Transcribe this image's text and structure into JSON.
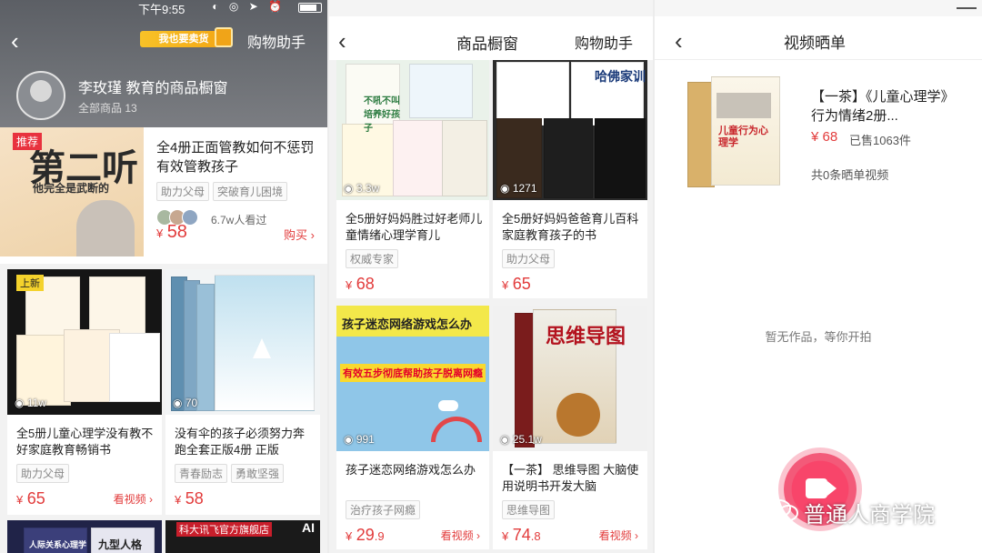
{
  "panel1": {
    "status_time": "下午9:55",
    "seller_button": "我也要卖货",
    "assistant": "购物助手",
    "shop_name": "李玫瑾     教育的商品橱窗",
    "product_count": "全部商品 13",
    "featured": {
      "tag": "推荐",
      "img_big": "第二听",
      "img_sub": "他完全是武断的",
      "title": "全4册正面管教如何不惩罚有效管教孩子",
      "chips": [
        "助力父母",
        "突破育儿困境"
      ],
      "viewers": "6.7w人看过",
      "currency": "¥",
      "price": "58",
      "buy": "购买"
    },
    "cards": [
      {
        "tag": "上新",
        "views": "11w",
        "title": "全5册儿童心理学没有教不好家庭教育畅销书",
        "chips": [
          "助力父母"
        ],
        "price": "65",
        "watch": "看视频"
      },
      {
        "views": "70",
        "title": "没有伞的孩子必须努力奔跑全套正版4册 正版",
        "chips": [
          "青春励志",
          "勇敢坚强"
        ],
        "price": "58"
      }
    ],
    "bottom_banner": "科大讯飞官方旗舰店",
    "bottom_ai": "AI",
    "bottom_books": [
      "人际关系心理学",
      "九型人格"
    ]
  },
  "panel2": {
    "title": "商品橱窗",
    "assistant": "购物助手",
    "cards": [
      {
        "views": "3.3w",
        "title": "全5册好妈妈胜过好老师儿童情绪心理学育儿",
        "chips": [
          "权威专家"
        ],
        "price": "68",
        "cover_text": "不吼不叫 培养好孩子"
      },
      {
        "views": "1271",
        "title": "全5册好妈妈爸爸育儿百科家庭教育孩子的书",
        "chips": [
          "助力父母"
        ],
        "price": "65",
        "cover_text": "哈佛家训"
      },
      {
        "views": "991",
        "title": "孩子迷恋网络游戏怎么办",
        "chips": [
          "治疗孩子网瘾"
        ],
        "price": "29",
        "price_dec": ".9",
        "watch": "看视频",
        "cover_title": "孩子迷恋网络游戏怎么办",
        "cover_sub": "有效五步彻底帮助孩子脱离网瘾"
      },
      {
        "views": "25.1w",
        "title": "【一茶】 思维导图 大脑使用说明书开发大脑",
        "chips": [
          "思维导图"
        ],
        "price": "74",
        "price_dec": ".8",
        "watch": "看视频",
        "cover_text": "思维导图"
      }
    ]
  },
  "panel3": {
    "title": "视频晒单",
    "product_name": "【一茶】《儿童心理学》行为情绪2册...",
    "price": "¥ 68",
    "sold": "已售1063件",
    "videos": "共0条晒单视频",
    "cover_text": "儿童行为心理学",
    "empty": "暂无作品，等你开拍",
    "watermark": "普通人商学院"
  },
  "colors": {
    "accent_red": "#e23b3b",
    "record_pink": "#f8456a",
    "seller_gold": "#f3a614"
  }
}
